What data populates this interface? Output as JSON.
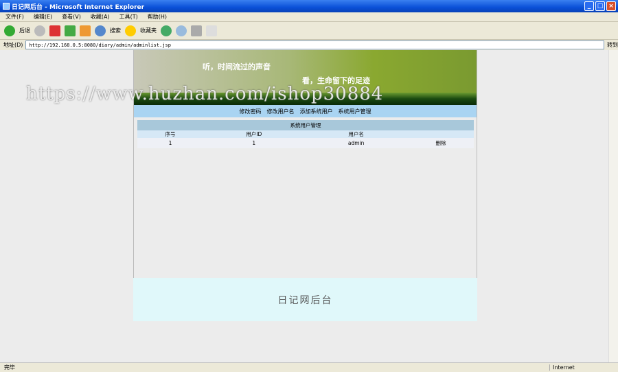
{
  "window": {
    "title": "日记网后台 - Microsoft Internet Explorer"
  },
  "menu": [
    "文件(F)",
    "编辑(E)",
    "查看(V)",
    "收藏(A)",
    "工具(T)",
    "帮助(H)"
  ],
  "toolbar": {
    "back": "后退",
    "search": "搜索",
    "favorites": "收藏夹"
  },
  "address": {
    "label": "地址(D)",
    "url": "http://192.168.0.5:8080/diary/admin/adminlist.jsp",
    "go": "转到"
  },
  "banner": {
    "line1": "听，时间流过的声音",
    "line2": "看，生命留下的足迹"
  },
  "nav": [
    "修改密码",
    "修改用户名",
    "添加系统用户",
    "系统用户管理"
  ],
  "table": {
    "caption": "系统用户管理",
    "headers": [
      "序号",
      "用户ID",
      "用户名",
      ""
    ],
    "rows": [
      {
        "no": "1",
        "id": "1",
        "name": "admin",
        "action": "删除"
      }
    ]
  },
  "footer": "日记网后台",
  "watermark": "https://www.huzhan.com/ishop30884",
  "status": {
    "text": "完毕",
    "zone": "Internet"
  }
}
